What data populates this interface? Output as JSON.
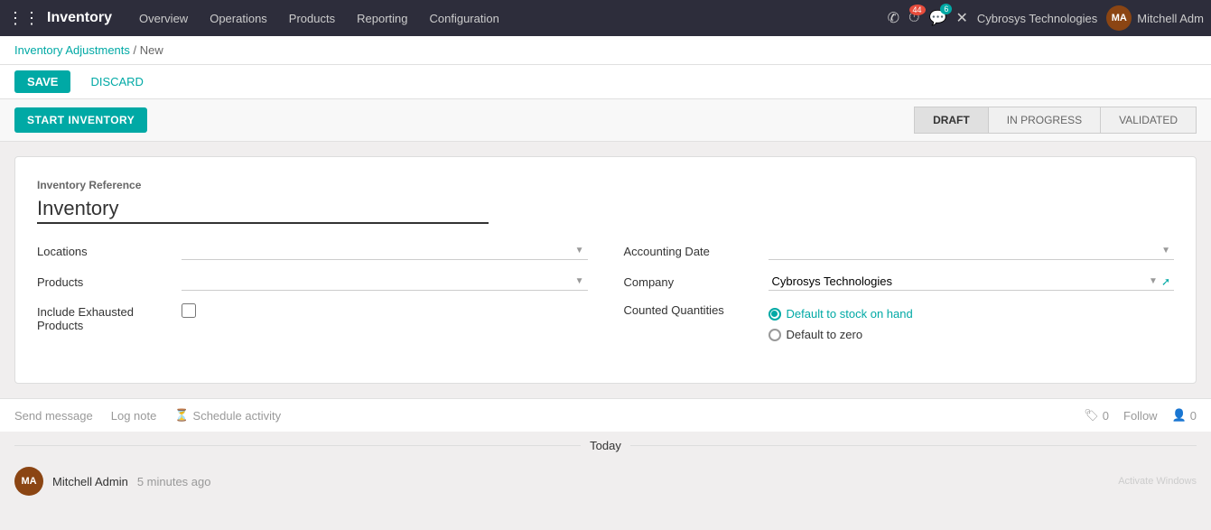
{
  "topnav": {
    "app_name": "Inventory",
    "nav_items": [
      "Overview",
      "Operations",
      "Products",
      "Reporting",
      "Configuration"
    ],
    "badge_44": "44",
    "badge_6": "6",
    "company": "Cybrosys Technologies",
    "user": "Mitchell Adm",
    "avatar_initials": "MA"
  },
  "breadcrumb": {
    "parent": "Inventory Adjustments",
    "current": "New"
  },
  "actions": {
    "save": "SAVE",
    "discard": "DISCARD",
    "start_inventory": "START INVENTORY"
  },
  "status_steps": [
    "DRAFT",
    "IN PROGRESS",
    "VALIDATED"
  ],
  "form": {
    "ref_label": "Inventory Reference",
    "ref_value": "Inventory",
    "locations_label": "Locations",
    "locations_value": "",
    "products_label": "Products",
    "products_value": "",
    "include_exhausted_label": "Include Exhausted Products",
    "accounting_date_label": "Accounting Date",
    "accounting_date_value": "",
    "company_label": "Company",
    "company_value": "Cybrosys Technologies",
    "counted_quantities_label": "Counted Quantities",
    "option1": "Default to stock on hand",
    "option2": "Default to zero"
  },
  "bottom": {
    "send_message": "Send message",
    "log_note": "Log note",
    "schedule_activity": "Schedule activity",
    "follow": "Follow",
    "comments_count": "0",
    "followers_count": "0"
  },
  "today_label": "Today",
  "mitchell_name": "Mitchell Admin",
  "mitchell_time": "5 minutes ago",
  "activate_windows": "Activate Windows"
}
